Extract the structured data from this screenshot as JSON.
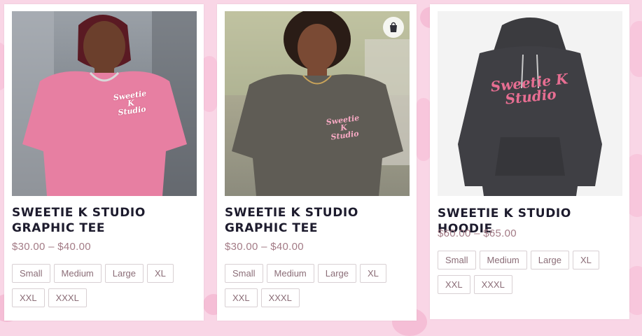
{
  "products": [
    {
      "title": "Sweetie K Studio Graphic Tee",
      "price": "$30.00 – $40.00",
      "sizes": [
        "Small",
        "Medium",
        "Large",
        "XL",
        "XXL",
        "XXXL"
      ],
      "logo_line1": "Sweetie K",
      "logo_line2": "Studio"
    },
    {
      "title": "Sweetie K Studio Graphic Tee",
      "price": "$30.00 – $40.00",
      "sizes": [
        "Small",
        "Medium",
        "Large",
        "XL",
        "XXL",
        "XXXL"
      ],
      "logo_line1": "Sweetie K",
      "logo_line2": "Studio",
      "quick_icon": "shopping-bag-icon"
    },
    {
      "title": "Sweetie K Studio Hoodie",
      "price": "$60.00 – $65.00",
      "sizes": [
        "Small",
        "Medium",
        "Large",
        "XL",
        "XXL",
        "XXXL"
      ],
      "logo_line1": "Sweetie K",
      "logo_line2": "Studio"
    }
  ],
  "colors": {
    "page_bg": "#f9d6e6",
    "title": "#1d1b2d",
    "price": "#a37b86",
    "brand_pink": "#e76e92"
  }
}
